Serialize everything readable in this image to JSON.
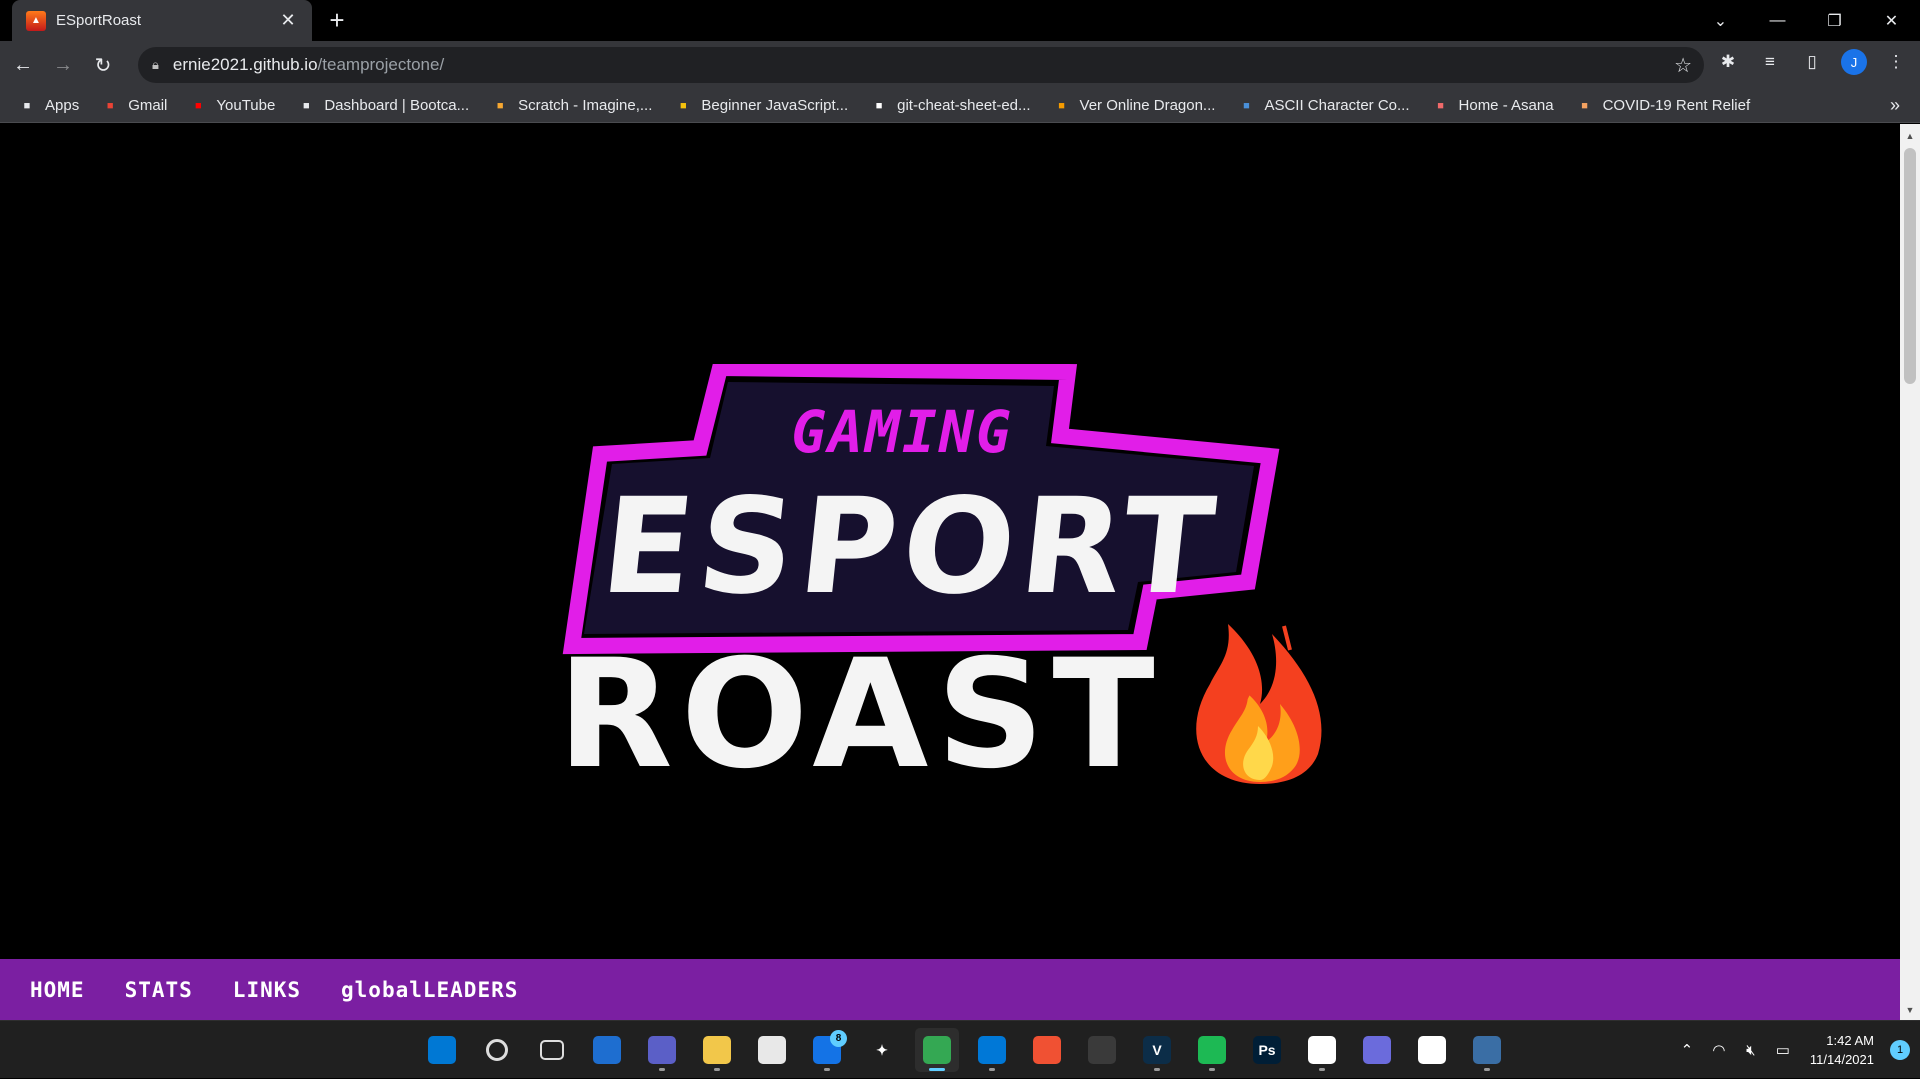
{
  "browser": {
    "tab": {
      "title": "ESportRoast"
    },
    "address": {
      "host": "ernie2021.github.io",
      "path": "/teamprojectone/"
    },
    "bookmarks": [
      {
        "label": "Apps",
        "icon": "apps-grid-icon",
        "color": "#e8eaed"
      },
      {
        "label": "Gmail",
        "icon": "gmail-icon",
        "color": "#ea4335"
      },
      {
        "label": "YouTube",
        "icon": "youtube-icon",
        "color": "#ff0000"
      },
      {
        "label": "Dashboard | Bootca...",
        "icon": "globe-icon",
        "color": "#e8eaed"
      },
      {
        "label": "Scratch - Imagine,...",
        "icon": "scratch-icon",
        "color": "#f7a831"
      },
      {
        "label": "Beginner JavaScript...",
        "icon": "crown-icon",
        "color": "#f4c20d"
      },
      {
        "label": "git-cheat-sheet-ed...",
        "icon": "github-icon",
        "color": "#ffffff"
      },
      {
        "label": "Ver Online Dragon...",
        "icon": "dragon-ball-icon",
        "color": "#f59b00"
      },
      {
        "label": "ASCII Character Co...",
        "icon": "pr-icon",
        "color": "#4a90d9"
      },
      {
        "label": "Home - Asana",
        "icon": "asana-icon",
        "color": "#f06a6a"
      },
      {
        "label": "COVID-19 Rent Relief",
        "icon": "covid-relief-icon",
        "color": "#f4a261"
      }
    ],
    "profile_initial": "J"
  },
  "logo": {
    "top_word": "GAMING",
    "middle_word": "ESPORT",
    "bottom_word": "ROAST",
    "accent_color": "#e11ee8",
    "panel_color": "#16102e",
    "text_color": "#f4f4f4"
  },
  "site_nav": {
    "items": [
      "HOME",
      "STATS",
      "LINKS",
      "globalLEADERS"
    ],
    "background": "#7b1fa2"
  },
  "taskbar": {
    "apps": [
      {
        "name": "start-button",
        "glyph": "",
        "bg": "#0078d4"
      },
      {
        "name": "search-button",
        "glyph": "",
        "bg": "transparent"
      },
      {
        "name": "task-view-button",
        "glyph": "",
        "bg": "transparent"
      },
      {
        "name": "widgets-button",
        "glyph": "",
        "bg": "#1e6ed0"
      },
      {
        "name": "teams-chat-button",
        "glyph": "",
        "bg": "#5b5fc7"
      },
      {
        "name": "file-explorer-button",
        "glyph": "",
        "bg": "#f2c74a"
      },
      {
        "name": "store-button",
        "glyph": "",
        "bg": "#e8e8e8"
      },
      {
        "name": "mail-button",
        "glyph": "",
        "bg": "#1473e6"
      },
      {
        "name": "dropbox-button",
        "glyph": "",
        "bg": "transparent"
      },
      {
        "name": "chrome-button",
        "glyph": "",
        "bg": "#34a853"
      },
      {
        "name": "vscode-button",
        "glyph": "",
        "bg": "#0078d7"
      },
      {
        "name": "git-button",
        "glyph": "",
        "bg": "#f05133"
      },
      {
        "name": "davinci-button",
        "glyph": "",
        "bg": "#3a3a3a"
      },
      {
        "name": "v-app-button",
        "glyph": "V",
        "bg": "#0c2d48"
      },
      {
        "name": "spotify-button",
        "glyph": "",
        "bg": "#1db954"
      },
      {
        "name": "photoshop-button",
        "glyph": "Ps",
        "bg": "#001e36"
      },
      {
        "name": "slack-button",
        "glyph": "",
        "bg": "#ffffff"
      },
      {
        "name": "eclipse-button",
        "glyph": "",
        "bg": "#6b6bdc"
      },
      {
        "name": "mongodb-button",
        "glyph": "",
        "bg": "#ffffff"
      },
      {
        "name": "mysql-workbench-button",
        "glyph": "",
        "bg": "#3a6ea5"
      }
    ],
    "mail_badge": "8",
    "time": "1:42 AM",
    "date": "11/14/2021",
    "notification_count": "1"
  }
}
